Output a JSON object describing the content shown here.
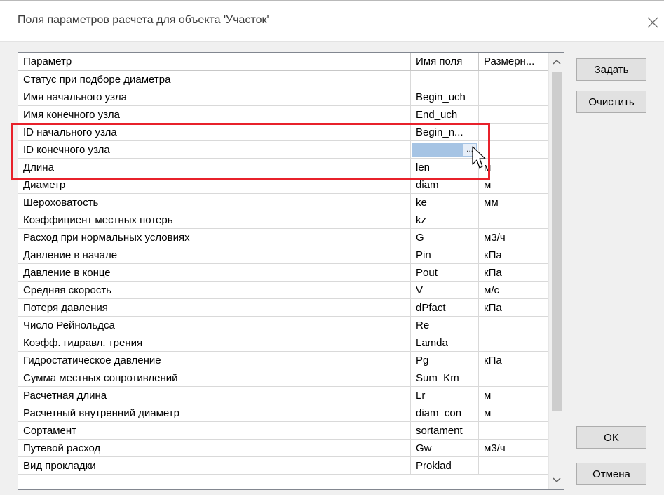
{
  "window": {
    "title": "Поля параметров расчета для объекта 'Участок'"
  },
  "grid": {
    "columns": [
      "Параметр",
      "Имя поля",
      "Размерн..."
    ],
    "rows": [
      {
        "param": "Статус при подборе диаметра",
        "field": "",
        "unit": ""
      },
      {
        "param": "Имя начального узла",
        "field": "Begin_uch",
        "unit": ""
      },
      {
        "param": "Имя конечного узла",
        "field": "End_uch",
        "unit": ""
      },
      {
        "param": "ID начального узла",
        "field": "Begin_n...",
        "unit": ""
      },
      {
        "param": "ID конечного узла",
        "field": "",
        "unit": ""
      },
      {
        "param": "Длина",
        "field": "len",
        "unit": "м"
      },
      {
        "param": "Диаметр",
        "field": "diam",
        "unit": "м"
      },
      {
        "param": "Шероховатость",
        "field": "ke",
        "unit": "мм"
      },
      {
        "param": "Коэффициент местных потерь",
        "field": "kz",
        "unit": ""
      },
      {
        "param": "Расход при нормальных условиях",
        "field": "G",
        "unit": "м3/ч"
      },
      {
        "param": "Давление в начале",
        "field": "Pin",
        "unit": "кПа"
      },
      {
        "param": "Давление в конце",
        "field": "Pout",
        "unit": "кПа"
      },
      {
        "param": "Средняя скорость",
        "field": "V",
        "unit": "м/с"
      },
      {
        "param": "Потеря давления",
        "field": "dPfact",
        "unit": "кПа"
      },
      {
        "param": "Число Рейнольдса",
        "field": "Re",
        "unit": ""
      },
      {
        "param": "Коэфф. гидравл. трения",
        "field": "Lamda",
        "unit": ""
      },
      {
        "param": "Гидростатическое давление",
        "field": "Pg",
        "unit": "кПа"
      },
      {
        "param": "Сумма местных сопротивлений",
        "field": "Sum_Km",
        "unit": ""
      },
      {
        "param": "Расчетная длина",
        "field": "Lr",
        "unit": "м"
      },
      {
        "param": "Расчетный внутренний диаметр",
        "field": "diam_con",
        "unit": "м"
      },
      {
        "param": "Сортамент",
        "field": "sortament",
        "unit": ""
      },
      {
        "param": "Путевой расход",
        "field": "Gw",
        "unit": "м3/ч"
      },
      {
        "param": "Вид прокладки",
        "field": "Proklad",
        "unit": ""
      }
    ],
    "edit_button_text": "..."
  },
  "buttons": {
    "set": "Задать",
    "clear": "Очистить",
    "ok": "OK",
    "cancel": "Отмена"
  },
  "icons": {
    "close": "close-icon",
    "scroll_up": "chevron-up-icon",
    "scroll_down": "chevron-down-icon",
    "cursor": "mouse-pointer-icon"
  },
  "colors": {
    "highlight": "#e8212b",
    "selection": "#a6c4e4"
  }
}
